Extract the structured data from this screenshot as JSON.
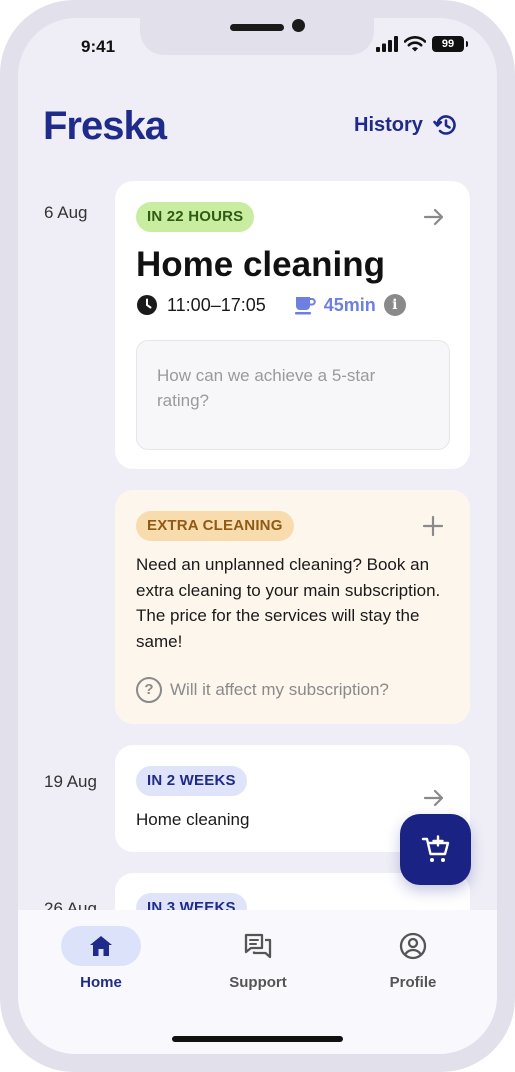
{
  "status_bar": {
    "time": "9:41",
    "battery": "99"
  },
  "header": {
    "logo": "Freska",
    "history_label": "History"
  },
  "bookings": [
    {
      "date": "6 Aug",
      "badge": "IN 22 HOURS",
      "title": "Home cleaning",
      "time_range": "11:00–17:05",
      "break_duration": "45min",
      "feedback_placeholder": "How can we achieve a 5-star rating?"
    },
    {
      "date": "19 Aug",
      "badge": "IN 2 WEEKS",
      "title": "Home cleaning"
    },
    {
      "date": "26 Aug",
      "badge": "IN 3 WEEKS"
    }
  ],
  "extra_cleaning": {
    "badge": "EXTRA CLEANING",
    "text": "Need an unplanned cleaning? Book an extra cleaning to your main subscription. The price for the services will stay the same!",
    "faq_link": "Will it affect my subscription?"
  },
  "tabs": [
    {
      "label": "Home",
      "icon": "home-icon",
      "active": true
    },
    {
      "label": "Support",
      "icon": "chat-icon",
      "active": false
    },
    {
      "label": "Profile",
      "icon": "profile-icon",
      "active": false
    }
  ],
  "colors": {
    "brand": "#1f2b8a",
    "badge_soon": "#c9eda0",
    "badge_extra": "#f8dcae",
    "badge_later": "#dfe4fb",
    "extra_card_bg": "#fdf6ec"
  }
}
